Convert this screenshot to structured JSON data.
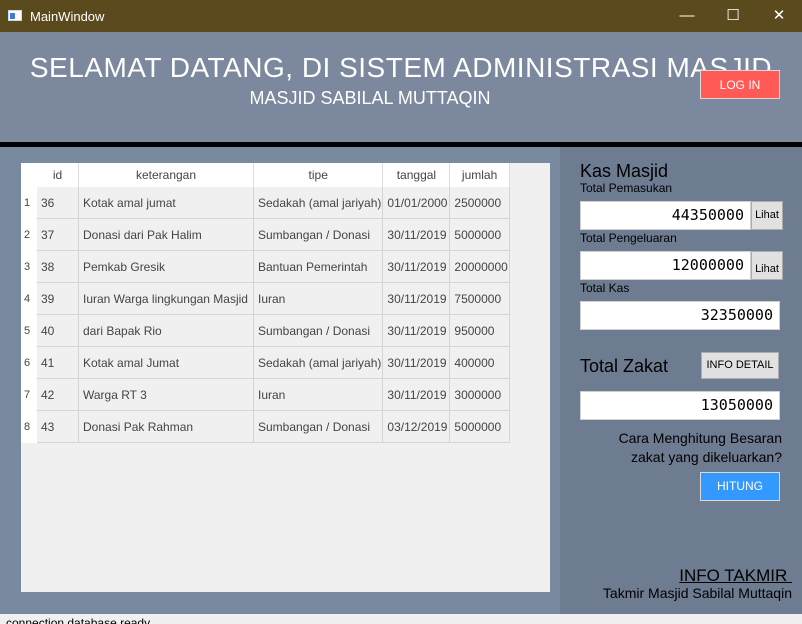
{
  "window": {
    "title": "MainWindow",
    "controls": [
      "—",
      "☐",
      "✕"
    ]
  },
  "header": {
    "title": "SELAMAT DATANG, DI SISTEM ADMINISTRASI MASJID",
    "subtitle": "MASJID SABILAL MUTTAQIN",
    "login_label": "LOG IN"
  },
  "table": {
    "columns": [
      "id",
      "keterangan",
      "tipe",
      "tanggal",
      "jumlah"
    ],
    "rows": [
      {
        "num": "1",
        "cells": [
          "36",
          "Kotak amal jumat",
          "Sedakah (amal jariyah)",
          "01/01/2000",
          "2500000"
        ]
      },
      {
        "num": "2",
        "cells": [
          "37",
          "Donasi dari Pak Halim",
          "Sumbangan / Donasi",
          "30/11/2019",
          "5000000"
        ]
      },
      {
        "num": "3",
        "cells": [
          "38",
          "Pemkab Gresik",
          "Bantuan Pemerintah",
          "30/11/2019",
          "20000000"
        ]
      },
      {
        "num": "4",
        "cells": [
          "39",
          "Iuran Warga lingkungan Masjid",
          "Iuran",
          "30/11/2019",
          "7500000"
        ]
      },
      {
        "num": "5",
        "cells": [
          "40",
          "dari Bapak Rio",
          "Sumbangan / Donasi",
          "30/11/2019",
          "950000"
        ]
      },
      {
        "num": "6",
        "cells": [
          "41",
          "Kotak amal Jumat",
          "Sedakah (amal jariyah)",
          "30/11/2019",
          "400000"
        ]
      },
      {
        "num": "7",
        "cells": [
          "42",
          "Warga RT 3",
          "Iuran",
          "30/11/2019",
          "3000000"
        ]
      },
      {
        "num": "8",
        "cells": [
          "43",
          "Donasi Pak Rahman",
          "Sumbangan / Donasi",
          "03/12/2019",
          "5000000"
        ]
      }
    ]
  },
  "kas": {
    "title": "Kas Masjid",
    "pemasukan_label": "Total Pemasukan",
    "pemasukan_value": "44350000",
    "pengeluaran_label": "Total Pengeluaran",
    "pengeluaran_value": "12000000",
    "kas_label": "Total Kas",
    "kas_value": "32350000",
    "lihat_label": "Lihat"
  },
  "zakat": {
    "title": "Total Zakat",
    "info_detail_label": "INFO DETAIL",
    "value": "13050000",
    "question_line1": "Cara Menghitung Besaran",
    "question_line2": "zakat yang dikeluarkan?",
    "hitung_label": "HITUNG"
  },
  "takmir": {
    "title": "INFO TAKMIR ",
    "subtitle": "Takmir Masjid Sabilal Muttaqin"
  },
  "status": {
    "text": "connection database ready"
  }
}
